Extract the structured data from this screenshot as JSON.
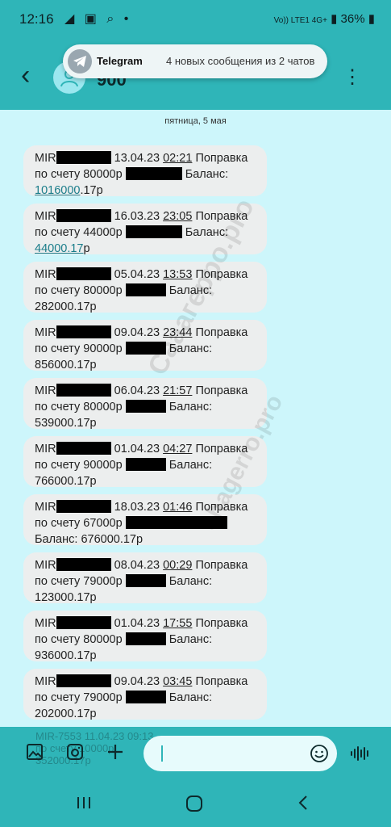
{
  "status": {
    "time": "12:16",
    "left_icons": "◢ ▣ ⌕ •",
    "network": "Vo)) LTE1 4G+",
    "battery": "36%"
  },
  "header": {
    "title": "900"
  },
  "notification": {
    "app": "Telegram",
    "text": "4 новых сообщения из 2 чатов"
  },
  "chat": {
    "date": "пятница, 5 мая",
    "messages": [
      {
        "prefix": "MIR",
        "date": "13.04.23",
        "time": "02:21",
        "title": "Поправка",
        "line2a": "по счету 80000р",
        "balance_label": "Баланс:",
        "balance_amount": "1016000",
        "balance_rest": ".17р"
      },
      {
        "prefix": "MIR",
        "date": "16.03.23",
        "time": "23:05",
        "title": "Поправка",
        "line2a": "по счету 44000р",
        "balance_label": "Баланс:",
        "balance_amount": "44000.17",
        "balance_rest": "р"
      },
      {
        "prefix": "MIR",
        "date": "05.04.23",
        "time": "13:53",
        "title": "Поправка",
        "line2a": "по счету 80000р",
        "balance_label": "Баланс:",
        "balance_amount": "282000.17р",
        "balance_rest": ""
      },
      {
        "prefix": "MIR",
        "date": "09.04.23",
        "time": "23:44",
        "title": "Поправка",
        "line2a": "по счету 90000р",
        "balance_label": "Баланс:",
        "balance_amount": "856000.17р",
        "balance_rest": ""
      },
      {
        "prefix": "MIR",
        "date": "06.04.23",
        "time": "21:57",
        "title": "Поправка",
        "line2a": "по счету 80000р",
        "balance_label": "Баланс:",
        "balance_amount": "539000.17р",
        "balance_rest": ""
      },
      {
        "prefix": "MIR",
        "date": "01.04.23",
        "time": "04:27",
        "title": "Поправка",
        "line2a": "по счету 90000р",
        "balance_label": "Баланс:",
        "balance_amount": "766000.17р",
        "balance_rest": ""
      },
      {
        "prefix": "MIR",
        "date": "18.03.23",
        "time": "01:46",
        "title": "Поправка",
        "line2a": "по счету 67000р",
        "balance_label": "Баланс:",
        "balance_amount": "676000.17р",
        "balance_rest": ""
      },
      {
        "prefix": "MIR",
        "date": "08.04.23",
        "time": "00:29",
        "title": "Поправка",
        "line2a": "по счету 79000р",
        "balance_label": "Баланс:",
        "balance_amount": "123000.17р",
        "balance_rest": ""
      },
      {
        "prefix": "MIR",
        "date": "01.04.23",
        "time": "17:55",
        "title": "Поправка",
        "line2a": "по счету 80000р",
        "balance_label": "Баланс:",
        "balance_amount": "936000.17р",
        "balance_rest": ""
      },
      {
        "prefix": "MIR",
        "date": "09.04.23",
        "time": "03:45",
        "title": "Поправка",
        "line2a": "по счету 79000р",
        "balance_label": "Баланс:",
        "balance_amount": "202000.17р",
        "balance_rest": ""
      }
    ],
    "partial_message": {
      "line1": "MIR-7553 11.04.23 09:13",
      "line2": "по счету 10000р",
      "line3": "352000.17р"
    },
    "watermark": "Сааагерро.pro",
    "watermark2": "сhagerro.pro"
  },
  "input": {
    "placeholder": ""
  },
  "colors": {
    "header_bg": "#2fb5b8",
    "chat_bg": "#cdf6fb",
    "bubble_bg": "#eceeee",
    "link": "#1a7d8a"
  }
}
